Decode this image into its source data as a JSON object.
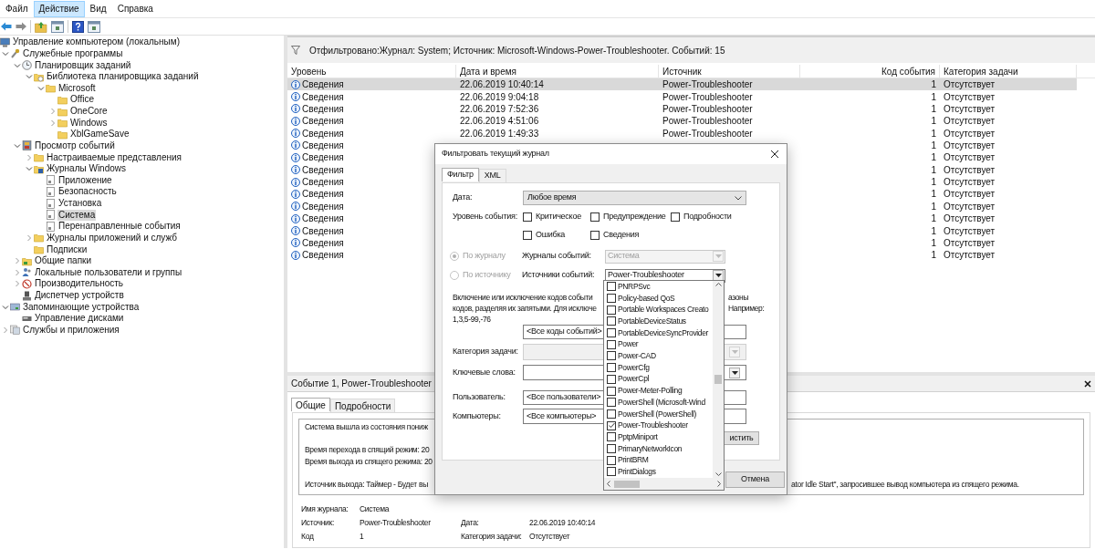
{
  "menu": [
    {
      "label": "Файл",
      "selected": false
    },
    {
      "label": "Действие",
      "selected": true
    },
    {
      "label": "Вид",
      "selected": false
    },
    {
      "label": "Справка",
      "selected": false
    }
  ],
  "tree": [
    {
      "label": "Управление компьютером (локальным)",
      "kind": "computer",
      "selected": false,
      "children": [
        {
          "label": "Служебные программы",
          "kind": "tools",
          "expanded": true,
          "selected": false,
          "children": [
            {
              "label": "Планировщик заданий",
              "kind": "clock",
              "expanded": true,
              "selected": false,
              "children": [
                {
                  "label": "Библиотека планировщика заданий",
                  "kind": "folder-clock",
                  "expanded": true,
                  "selected": false,
                  "children": [
                    {
                      "label": "Microsoft",
                      "kind": "folder",
                      "expanded": true,
                      "selected": false,
                      "children": [
                        {
                          "label": "Office",
                          "kind": "folder",
                          "selected": false
                        },
                        {
                          "label": "OneCore",
                          "kind": "folder",
                          "expanded": false,
                          "selected": false
                        },
                        {
                          "label": "Windows",
                          "kind": "folder",
                          "expanded": false,
                          "selected": false
                        },
                        {
                          "label": "XblGameSave",
                          "kind": "folder",
                          "selected": false
                        }
                      ]
                    }
                  ]
                }
              ]
            },
            {
              "label": "Просмотр событий",
              "kind": "viewer",
              "expanded": true,
              "selected": false,
              "children": [
                {
                  "label": "Настраиваемые представления",
                  "kind": "folder",
                  "expanded": false,
                  "selected": false
                },
                {
                  "label": "Журналы Windows",
                  "kind": "folder-log",
                  "expanded": true,
                  "selected": false,
                  "children": [
                    {
                      "label": "Приложение",
                      "kind": "log",
                      "selected": false
                    },
                    {
                      "label": "Безопасность",
                      "kind": "log",
                      "selected": false
                    },
                    {
                      "label": "Установка",
                      "kind": "log",
                      "selected": false
                    },
                    {
                      "label": "Система",
                      "kind": "log",
                      "selected": true
                    },
                    {
                      "label": "Перенаправленные события",
                      "kind": "log",
                      "selected": false
                    }
                  ]
                },
                {
                  "label": "Журналы приложений и служб",
                  "kind": "folder",
                  "expanded": false,
                  "selected": false
                },
                {
                  "label": "Подписки",
                  "kind": "folder",
                  "selected": false
                }
              ]
            },
            {
              "label": "Общие папки",
              "kind": "share",
              "expanded": false,
              "selected": false
            },
            {
              "label": "Локальные пользователи и группы",
              "kind": "users",
              "expanded": false,
              "selected": false
            },
            {
              "label": "Производительность",
              "kind": "perf",
              "expanded": false,
              "selected": false
            },
            {
              "label": "Диспетчер устройств",
              "kind": "device",
              "selected": false
            }
          ]
        },
        {
          "label": "Запоминающие устройства",
          "kind": "storage",
          "expanded": true,
          "selected": false,
          "children": [
            {
              "label": "Управление дисками",
              "kind": "disk",
              "selected": false
            }
          ]
        },
        {
          "label": "Службы и приложения",
          "kind": "services",
          "expanded": false,
          "selected": false
        }
      ]
    }
  ],
  "filter_bar": {
    "text": "Отфильтровано:Журнал: System; Источник: Microsoft-Windows-Power-Troubleshooter. Событий: 15"
  },
  "table": {
    "columns": [
      "Уровень",
      "Дата и время",
      "Источник",
      "Код события",
      "Категория задачи"
    ],
    "rows": [
      {
        "level": "Сведения",
        "date": "22.06.2019 10:40:14",
        "source": "Power-Troubleshooter",
        "code": "1",
        "category": "Отсутствует",
        "selected": true
      },
      {
        "level": "Сведения",
        "date": "22.06.2019 9:04:18",
        "source": "Power-Troubleshooter",
        "code": "1",
        "category": "Отсутствует",
        "selected": false
      },
      {
        "level": "Сведения",
        "date": "22.06.2019 7:52:36",
        "source": "Power-Troubleshooter",
        "code": "1",
        "category": "Отсутствует",
        "selected": false
      },
      {
        "level": "Сведения",
        "date": "22.06.2019 4:51:06",
        "source": "Power-Troubleshooter",
        "code": "1",
        "category": "Отсутствует",
        "selected": false
      },
      {
        "level": "Сведения",
        "date": "22.06.2019 1:49:33",
        "source": "Power-Troubleshooter",
        "code": "1",
        "category": "Отсутствует",
        "selected": false
      },
      {
        "level": "Сведения",
        "code": "1",
        "category": "Отсутствует",
        "selected": false
      },
      {
        "level": "Сведения",
        "code": "1",
        "category": "Отсутствует",
        "selected": false
      },
      {
        "level": "Сведения",
        "code": "1",
        "category": "Отсутствует",
        "selected": false
      },
      {
        "level": "Сведения",
        "code": "1",
        "category": "Отсутствует",
        "selected": false
      },
      {
        "level": "Сведения",
        "code": "1",
        "category": "Отсутствует",
        "selected": false
      },
      {
        "level": "Сведения",
        "code": "1",
        "category": "Отсутствует",
        "selected": false
      },
      {
        "level": "Сведения",
        "code": "1",
        "category": "Отсутствует",
        "selected": false
      },
      {
        "level": "Сведения",
        "code": "1",
        "category": "Отсутствует",
        "selected": false
      },
      {
        "level": "Сведения",
        "code": "1",
        "category": "Отсутствует",
        "selected": false
      },
      {
        "level": "Сведения",
        "code": "1",
        "category": "Отсутствует",
        "selected": false
      }
    ]
  },
  "event": {
    "title": "Событие 1, Power-Troubleshooter",
    "tabs": [
      {
        "label": "Общие",
        "selected": true
      },
      {
        "label": "Подробности",
        "selected": false
      }
    ],
    "paragraphs": [
      {
        "lines": [
          {
            "parts": [
              "Система вышла из состояния пониж"
            ]
          }
        ]
      },
      {
        "lines": [
          {
            "parts": [
              "Время перехода в спящий режим: 20"
            ]
          },
          {
            "parts": [
              "Время выхода из спящего режима: 20"
            ]
          }
        ]
      },
      {
        "lines": [
          {
            "parts": [
              "Источник выхода: Таймер - Будет вы",
              "ator Idle Start\", запросившее вывод компьютера из спящего режима."
            ]
          }
        ]
      }
    ],
    "details": [
      [
        {
          "label": "Имя журнала:",
          "value": "Система"
        }
      ],
      [
        {
          "label": "Источник:",
          "value": "Power-Troubleshooter"
        },
        {
          "label": "Дата:",
          "value": "22.06.2019 10:40:14"
        }
      ],
      [
        {
          "label": "Код",
          "value": "1"
        },
        {
          "label": "Категория задачи:",
          "value": "Отсутствует"
        }
      ]
    ]
  },
  "dialog": {
    "title": "Фильтровать текущий журнал",
    "tabs": [
      {
        "label": "Фильтр",
        "selected": true
      },
      {
        "label": "XML",
        "selected": false
      }
    ],
    "date": {
      "label": "Дата:",
      "value": "Любое время"
    },
    "levels": {
      "label": "Уровень события:",
      "options": [
        {
          "label": "Критическое",
          "checked": false
        },
        {
          "label": "Предупреждение",
          "checked": false
        },
        {
          "label": "Подробности",
          "checked": false
        },
        {
          "label": "Ошибка",
          "checked": false
        },
        {
          "label": "Сведения",
          "checked": false
        }
      ]
    },
    "scope": [
      {
        "label": "По журналу",
        "selected": true,
        "disabled": true,
        "field_label": "Журналы событий:",
        "value": "Система",
        "field_disabled": true
      },
      {
        "label": "По источнику",
        "selected": false,
        "disabled": true,
        "field_label": "Источники событий:",
        "value": "Power-Troubleshooter",
        "field_disabled": false
      }
    ],
    "hint_lines": [
      {
        "parts": [
          "Включение или исключение кодов событи",
          "азоны"
        ]
      },
      {
        "parts": [
          "кодов, разделяя их запятыми. Для исключе",
          "Например:"
        ]
      },
      {
        "parts": [
          "1,3,5-99,-76"
        ]
      }
    ],
    "fields": [
      {
        "kind": "text",
        "value": "<Все коды событий>",
        "disabled": false
      },
      {
        "kind": "dropdown",
        "label": "Категория задачи:",
        "disabled": true
      },
      {
        "kind": "dropdown",
        "label": "Ключевые слова:",
        "disabled": false
      },
      {
        "kind": "text",
        "label": "Пользователь:",
        "value": "<Все пользователи>",
        "disabled": false
      },
      {
        "kind": "text",
        "label": "Компьютеры:",
        "value": "<Все компьютеры>",
        "disabled": false
      }
    ],
    "clear_button": "истить",
    "cancel_button": "Отмена",
    "source_list": [
      {
        "label": "PNRPSvc",
        "checked": false
      },
      {
        "label": "Policy-based QoS",
        "checked": false
      },
      {
        "label": "Portable Workspaces Creato",
        "checked": false
      },
      {
        "label": "PortableDeviceStatus",
        "checked": false
      },
      {
        "label": "PortableDeviceSyncProvider",
        "checked": false
      },
      {
        "label": "Power",
        "checked": false
      },
      {
        "label": "Power-CAD",
        "checked": false
      },
      {
        "label": "PowerCfg",
        "checked": false
      },
      {
        "label": "PowerCpl",
        "checked": false
      },
      {
        "label": "Power-Meter-Polling",
        "checked": false
      },
      {
        "label": "PowerShell (Microsoft-Wind",
        "checked": false
      },
      {
        "label": "PowerShell (PowerShell)",
        "checked": false
      },
      {
        "label": "Power-Troubleshooter",
        "checked": true
      },
      {
        "label": "PptpMiniport",
        "checked": false
      },
      {
        "label": "PrimaryNetworkIcon",
        "checked": false
      },
      {
        "label": "PrintBRM",
        "checked": false
      },
      {
        "label": "PrintDialogs",
        "checked": false
      }
    ]
  }
}
